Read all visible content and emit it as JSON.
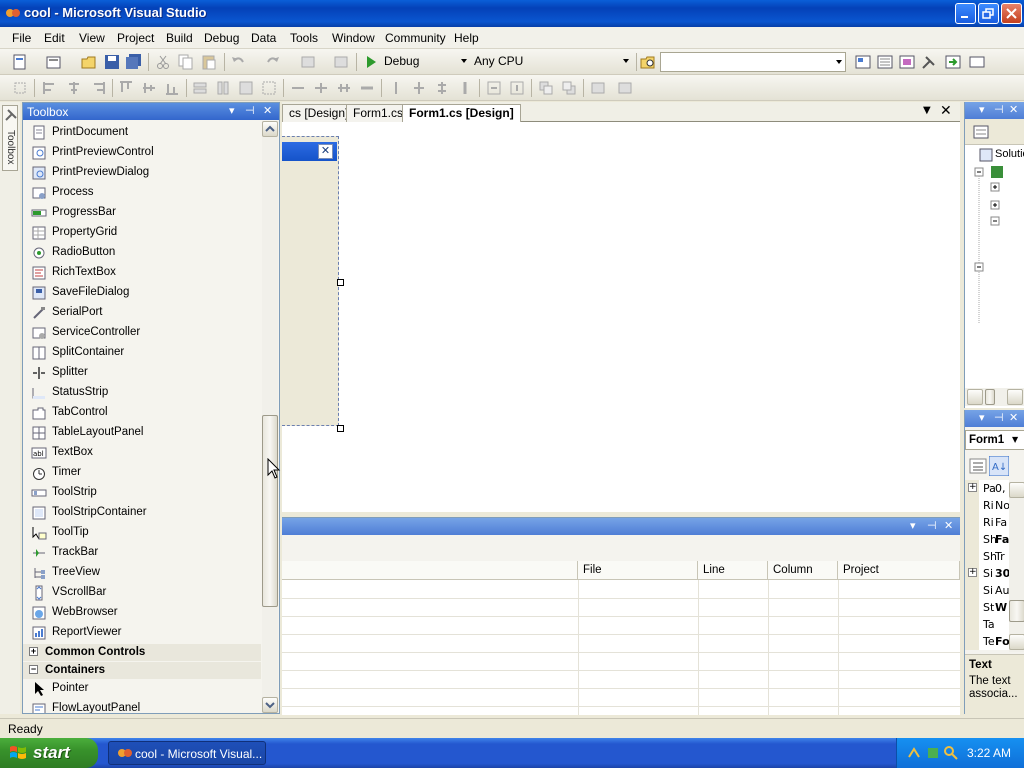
{
  "window": {
    "title": "cool - Microsoft Visual Studio"
  },
  "menu": [
    "File",
    "Edit",
    "View",
    "Project",
    "Build",
    "Debug",
    "Data",
    "Tools",
    "Window",
    "Community",
    "Help"
  ],
  "toolbar": {
    "config": "Debug",
    "platform": "Any CPU"
  },
  "side_tab": {
    "label": "Toolbox"
  },
  "toolbox": {
    "title": "Toolbox",
    "items": [
      "PrintDocument",
      "PrintPreviewControl",
      "PrintPreviewDialog",
      "Process",
      "ProgressBar",
      "PropertyGrid",
      "RadioButton",
      "RichTextBox",
      "SaveFileDialog",
      "SerialPort",
      "ServiceController",
      "SplitContainer",
      "Splitter",
      "StatusStrip",
      "TabControl",
      "TableLayoutPanel",
      "TextBox",
      "Timer",
      "ToolStrip",
      "ToolStripContainer",
      "ToolTip",
      "TrackBar",
      "TreeView",
      "VScrollBar",
      "WebBrowser",
      "ReportViewer"
    ],
    "groups": [
      {
        "label": "Common Controls",
        "sign": "+"
      },
      {
        "label": "Containers",
        "sign": "−"
      }
    ],
    "container_items": [
      "Pointer",
      "FlowLayoutPanel"
    ]
  },
  "doc_tabs": [
    "cs [Design]",
    "Form1.cs",
    "Form1.cs [Design]"
  ],
  "error_list": {
    "columns": [
      "File",
      "Line",
      "Column",
      "Project"
    ]
  },
  "solution": {
    "label": "Solutio"
  },
  "properties": {
    "object": "Form1",
    "rows": [
      "Pa",
      "Ri",
      "Ri",
      "Sh",
      "Sh",
      "Si",
      "Si",
      "St",
      "Ta",
      "Te"
    ],
    "row_values": [
      "0,",
      "No",
      "Fa",
      "Fa",
      "Tr",
      "30",
      "Au",
      "W",
      "",
      "Fo"
    ],
    "desc_title": "Text",
    "desc_text": "The text associa..."
  },
  "status": "Ready",
  "taskbar": {
    "start": "start",
    "task": "cool - Microsoft Visual...",
    "clock": "3:22 AM"
  }
}
